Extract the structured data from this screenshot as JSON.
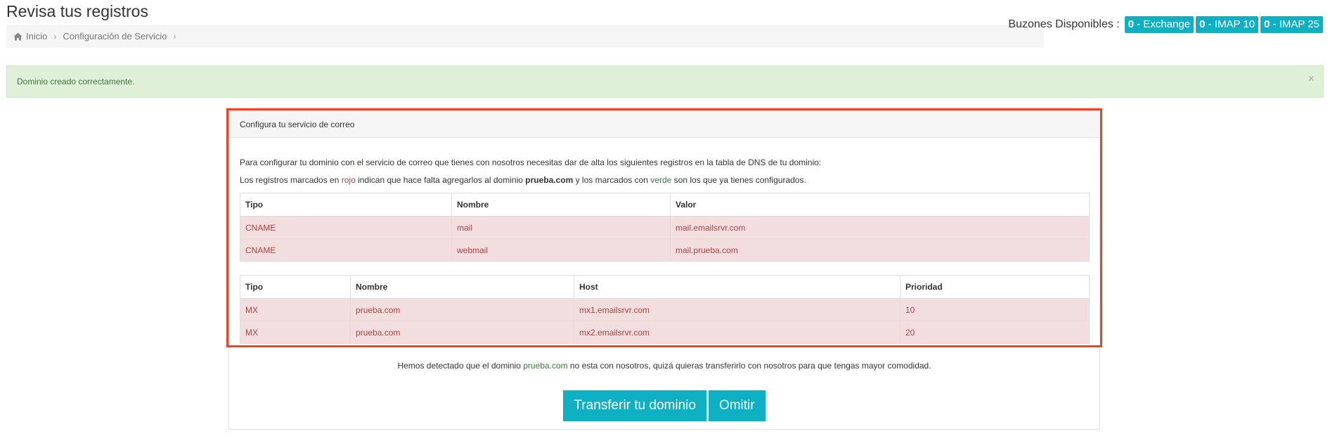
{
  "page": {
    "title": "Revisa tus registros"
  },
  "breadcrumb": {
    "items": [
      "Inicio",
      "Configuración de Servicio"
    ]
  },
  "mailboxes": {
    "label": "Buzones Disponibles :",
    "badges": [
      {
        "count": "0",
        "name": " - Exchange"
      },
      {
        "count": "0",
        "name": " - IMAP 10"
      },
      {
        "count": "0",
        "name": " - IMAP 25"
      }
    ]
  },
  "alert": {
    "message": "Dominio creado correctamente.",
    "close": "×"
  },
  "panel": {
    "heading": "Configura tu servicio de correo",
    "intro": "Para configurar tu dominio con el servicio de correo que tienes con nosotros necesitas dar de alta los siguientes registros en la tabla de DNS de tu dominio:",
    "legend": {
      "p1": "Los registros marcados en ",
      "red_word": "rojo",
      "p2": " indican que hace falta agregarlos al dominio ",
      "domain": "prueba.com",
      "p3": " y los marcados con ",
      "green_word": "verde",
      "p4": " son los que ya tienes configurados."
    },
    "cname_table": {
      "headers": [
        "Tipo",
        "Nombre",
        "Valor"
      ],
      "rows": [
        [
          "CNAME",
          "mail",
          "mail.emailsrvr.com"
        ],
        [
          "CNAME",
          "webmail",
          "mail.prueba.com"
        ]
      ]
    },
    "mx_table": {
      "headers": [
        "Tipo",
        "Nombre",
        "Host",
        "Prioridad"
      ],
      "rows": [
        [
          "MX",
          "prueba.com",
          "mx1.emailsrvr.com",
          "10"
        ],
        [
          "MX",
          "prueba.com",
          "mx2.emailsrvr.com",
          "20"
        ]
      ]
    },
    "transfer": {
      "p1": "Hemos detectado que el dominio ",
      "domain": "prueba.com",
      "p2": " no esta con nosotros, quizá quieras transferirlo con nosotros para que tengas mayor comodidad."
    },
    "buttons": {
      "transfer": "Transferir tu dominio",
      "skip": "Omitir"
    }
  },
  "colors": {
    "accent": "#0fb0c3",
    "highlight": "#f0421f",
    "error_bg": "#f2dede",
    "success_bg": "#dff0d8"
  }
}
